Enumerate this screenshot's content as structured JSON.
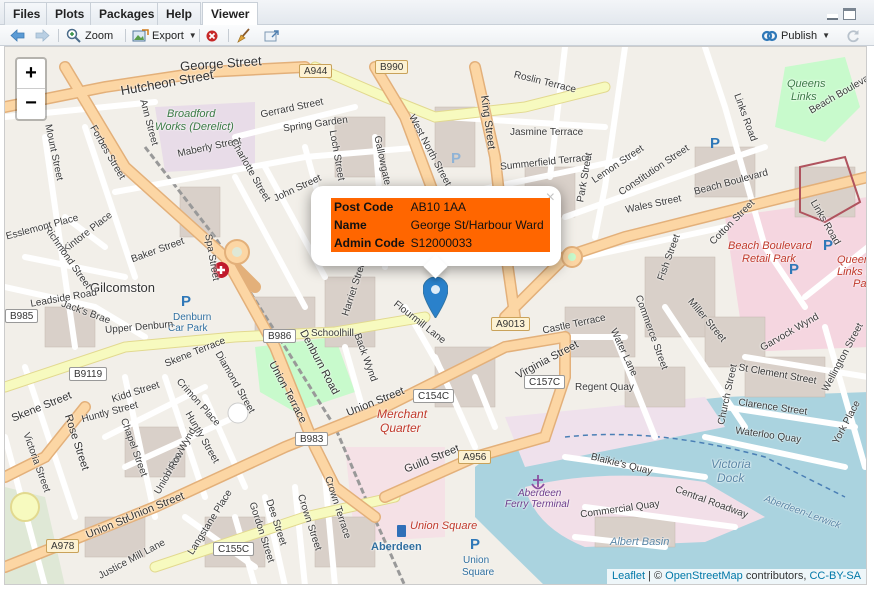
{
  "tabs": [
    {
      "label": "Files"
    },
    {
      "label": "Plots"
    },
    {
      "label": "Packages"
    },
    {
      "label": "Help"
    },
    {
      "label": "Viewer",
      "active": true
    }
  ],
  "toolbar": {
    "zoom_label": "Zoom",
    "export_label": "Export",
    "publish_label": "Publish"
  },
  "popup": {
    "rows": [
      {
        "key": "Post Code",
        "value": "AB10 1AA"
      },
      {
        "key": "Name",
        "value": "George St/Harbour Ward"
      },
      {
        "key": "Admin Code",
        "value": "S12000033"
      }
    ],
    "header_color": "#ff6600",
    "close_glyph": "×"
  },
  "zoom": {
    "in": "+",
    "out": "−"
  },
  "attribution": {
    "leaflet": "Leaflet",
    "sep": " | © ",
    "osm": "OpenStreetMap",
    "contrib": " contributors, ",
    "license": "CC-BY-SA"
  },
  "map_labels": {
    "george_street": "George Street",
    "hutcheon_street": "Hutcheon Street",
    "broadford": "Broadford",
    "works": "Works (Derelict)",
    "maberly_street": "Maberly Street",
    "gerrard_street": "Gerrard Street",
    "spring_garden": "Spring Garden",
    "west_north_street": "West North Street",
    "king_street": "King Street",
    "roslin_terrace": "Roslin Terrace",
    "jasmine_terrace": "Jasmine Terrace",
    "summerfield_terrace": "Summerfield Terrace",
    "park_street": "Park Street",
    "lemon_street": "Lemon Street",
    "constitution_street": "Constitution Street",
    "queens": "Queens",
    "links": "Links",
    "beach_boulevard": "Beach Boulevard",
    "links_road": "Links Road",
    "wales_street": "Wales Street",
    "cotton_street": "Cotton Street",
    "beach_boulevard_retail": "Beach Boulevard",
    "retail_park": "Retail Park",
    "queens_links": "Queens",
    "links_le": "Links Le",
    "pa": "Pa",
    "gilcomston": "Gilcomston",
    "denburn": "Denburn",
    "car_park": "Car Park",
    "upper_denburn": "Upper Denburn",
    "schoolhill": "Schoolhill",
    "denburn_road": "Denburn Road",
    "union_terrace": "Union Terrace",
    "skene_terrace": "Skene Terrace",
    "union_street": "Union Street",
    "union_street_w": "Union Street",
    "skene_street": "Skene Street",
    "rose_street": "Rose Street",
    "victoria_street": "Victoria Street",
    "kidd_street": "Kidd Street",
    "huntly_street": "Huntly Street",
    "chapel_street": "Chapel Street",
    "crimon_place": "Crimon Place",
    "merchant": "Merchant",
    "quarter": "Quarter",
    "virginia_street": "Virginia Street",
    "regent_quay": "Regent Quay",
    "waterloo_quay": "Waterloo Quay",
    "guild_street": "Guild Street",
    "victoria_dock": "Victoria",
    "dock": "Dock",
    "aberdeen_lerwick": "Aberdeen-Lerwick",
    "albert_basin": "Albert Basin",
    "aberdeen_ferry": "Aberdeen",
    "ferry_terminal": "Ferry Terminal",
    "union_square": "Union Square",
    "aberdeen": "Aberdeen",
    "union_square_stop": "Union",
    "square": "Square",
    "miller_street": "Miller Street",
    "garvock_wynd": "Garvock Wynd",
    "st_clement_street": "St Clement Street",
    "church_street": "Church Street",
    "clarence_street": "Clarence Street",
    "york_place": "York Place",
    "commerce_street": "Commerce Street",
    "water_lane": "Water Lane",
    "castle_terrace": "Castle Terrace",
    "flourmill_lane": "Flourmill Lane",
    "harriet_street": "Harriet Street",
    "back_wynd": "Back Wynd",
    "diamond_street": "Diamond Street",
    "baker_street": "Baker Street",
    "kintore_place": "Kintore Place",
    "richmond_street": "Richmond Street",
    "leadside_road": "Leadside Road",
    "jacks_brae": "Jack's Brae",
    "esslemont_place": "Esslemont Place",
    "blaikies_quay": "Blaikie's Quay",
    "central_roadway": "Central Roadway",
    "commercial_quay": "Commercial Quay",
    "justice_mill_lane": "Justice Mill Lane",
    "langstane_place": "Langstane Place",
    "gordon_street": "Gordon Street",
    "dee_street": "Dee Street",
    "crown_street": "Crown Street",
    "crown_terrace": "Crown Terrace",
    "union_row": "Union Row",
    "union_wynd": "Union Wynd",
    "mount_street": "Mount Street",
    "forbes_street": "Forbes Street",
    "ann_street": "Ann Street",
    "charlotte_street": "Charlotte Street",
    "john_street": "John Street",
    "loch_street": "Loch Street",
    "gallowgate": "Gallowgate",
    "fish_street": "Fish Street",
    "wellington_street": "Wellington Street",
    "union_str": "Union Str",
    "spa_street": "Spa Street"
  },
  "shields": [
    "A944",
    "B990",
    "B985",
    "B986",
    "A9013",
    "B9119",
    "C157C",
    "C154C",
    "B983",
    "A956",
    "A978",
    "C155C"
  ],
  "colors": {
    "marker": "#2a81cb",
    "hospital": "#c0192b",
    "water": "#aad3df",
    "land": "#f2efe9",
    "building": "#d9d0c9",
    "primary_road": "#fcd6a4",
    "secondary_road": "#f7fabf"
  }
}
